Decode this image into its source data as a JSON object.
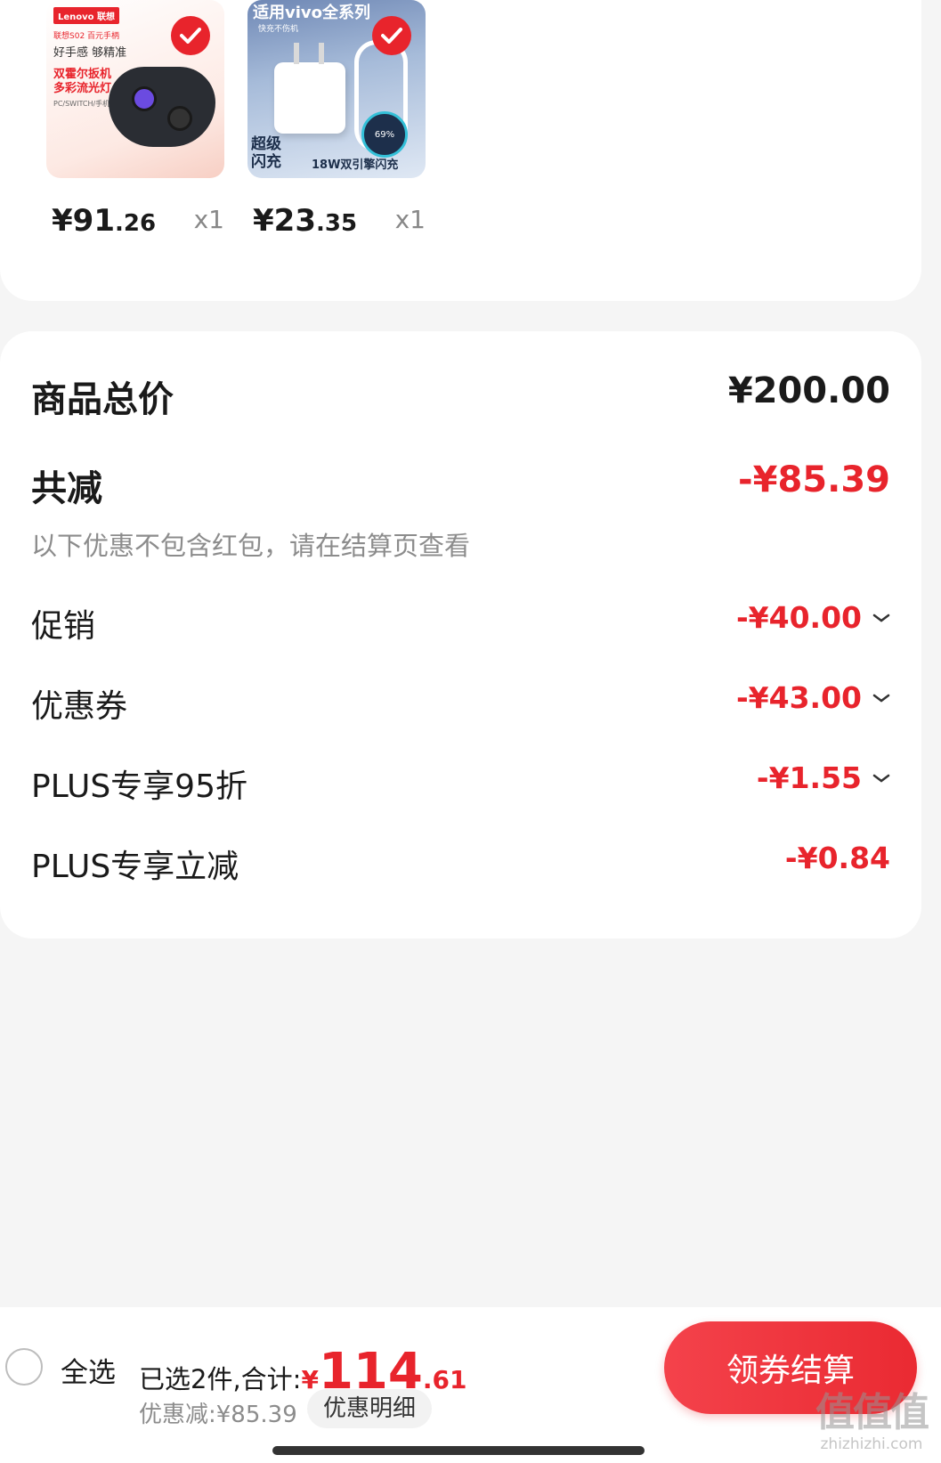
{
  "products": [
    {
      "brand": "Lenovo 联想",
      "badge": "联想S02 百元手柄",
      "tagline": "好手感 够精准",
      "feature": "双霍尔扳机 多彩流光灯",
      "platforms": "PC/SWITCH/手机",
      "price_int": "¥91",
      "price_dec": ".26",
      "qty": "x1"
    },
    {
      "headline": "适用vivo全系列",
      "subline": "快充不伤机",
      "gauge": "69%",
      "corner_text": "超级 闪充",
      "bottom_text": "18W双引擎闪充",
      "price_int": "¥23",
      "price_dec": ".35",
      "qty": "x1"
    }
  ],
  "summary": {
    "total_label": "商品总价",
    "total_value": "¥200.00",
    "reduce_label": "共减",
    "reduce_value": "-¥85.39",
    "note": "以下优惠不包含红包，请在结算页查看",
    "items": [
      {
        "label": "促销",
        "value": "-¥40.00",
        "expandable": true
      },
      {
        "label": "优惠券",
        "value": "-¥43.00",
        "expandable": true
      },
      {
        "label": "PLUS专享95折",
        "value": "-¥1.55",
        "expandable": true
      },
      {
        "label": "PLUS专享立减",
        "value": "-¥0.84",
        "expandable": false
      }
    ]
  },
  "bottom_bar": {
    "select_all": "全选",
    "selected_text": "已选2件,合计:",
    "total_currency": "¥",
    "total_int": "114",
    "total_dec": ".61",
    "discount_text": "优惠减:¥85.39",
    "detail_button": "优惠明细",
    "checkout_button": "领券结算"
  },
  "watermark": {
    "mark": "值值值",
    "site": "zhizhizhi.com"
  },
  "colors": {
    "accent": "#e8242c",
    "background": "#f5f5f5",
    "muted_text": "#8c8c8c"
  }
}
